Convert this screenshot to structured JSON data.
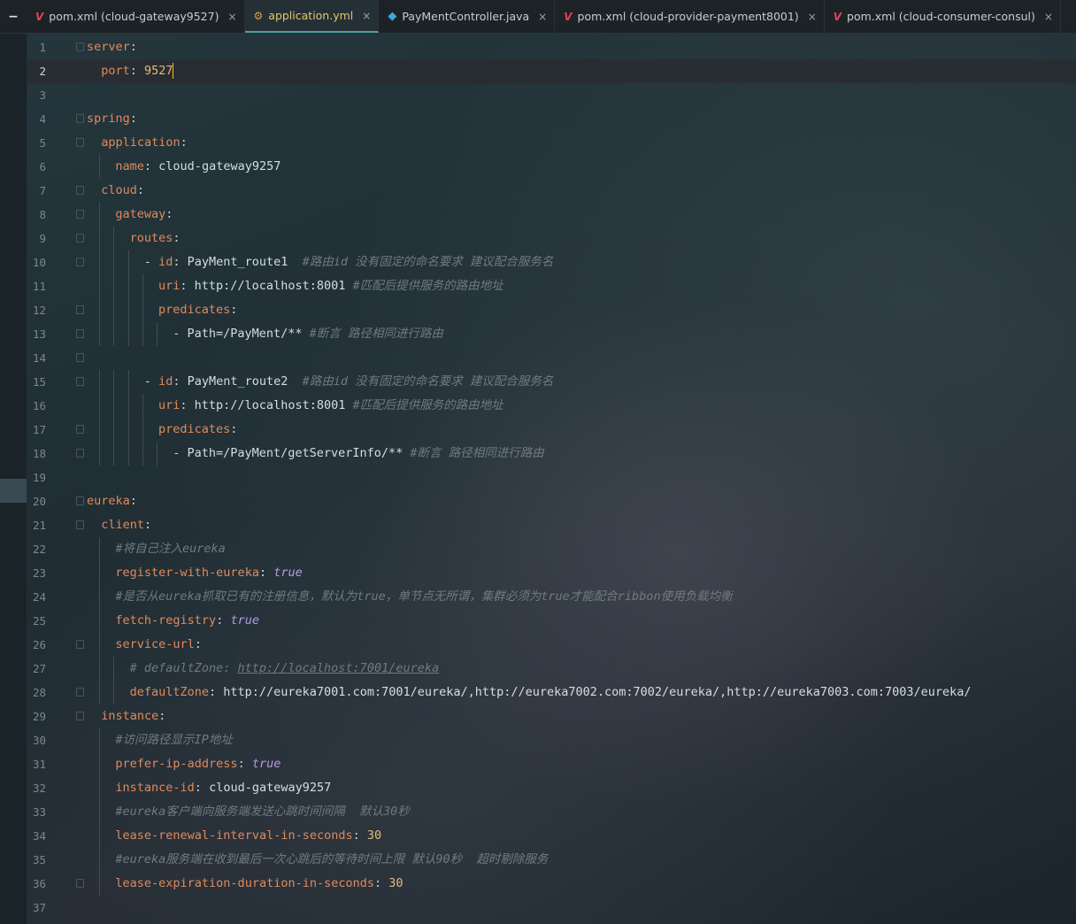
{
  "tabs": [
    {
      "label": "pom.xml (cloud-gateway9527)",
      "icon": "maven-icon",
      "active": false
    },
    {
      "label": "application.yml",
      "icon": "yaml-icon",
      "active": true
    },
    {
      "label": "PayMentController.java",
      "icon": "java-class-icon",
      "active": false
    },
    {
      "label": "pom.xml (cloud-provider-payment8001)",
      "icon": "maven-icon",
      "active": false
    },
    {
      "label": "pom.xml (cloud-consumer-consul)",
      "icon": "maven-icon",
      "active": false
    }
  ],
  "tab_collapse_glyph": "−",
  "tab_close_glyph": "×",
  "colors": {
    "key": "#e08a5b",
    "number": "#e8b873",
    "boolean": "#b79ae6",
    "comment": "#6f7b80",
    "caret": "#f0c020",
    "active_tab_text": "#e8c66a"
  },
  "editor": {
    "current_line": 2,
    "lines": [
      {
        "n": "1",
        "key": "server",
        "sep": ":"
      },
      {
        "n": "2",
        "key": "port",
        "sep": ": ",
        "val": "9527",
        "vt": "n"
      },
      {
        "n": "3"
      },
      {
        "n": "4",
        "key": "spring",
        "sep": ":"
      },
      {
        "n": "5",
        "key": "application",
        "sep": ":"
      },
      {
        "n": "6",
        "key": "name",
        "sep": ": ",
        "val": "cloud-gateway9257"
      },
      {
        "n": "7",
        "key": "cloud",
        "sep": ":"
      },
      {
        "n": "8",
        "key": "gateway",
        "sep": ":"
      },
      {
        "n": "9",
        "key": "routes",
        "sep": ":"
      },
      {
        "n": "10",
        "pre": "- ",
        "key": "id",
        "sep": ": ",
        "val": "PayMent_route1",
        "cm": "  #路由id 没有固定的命名要求 建议配合服务名"
      },
      {
        "n": "11",
        "key": "uri",
        "sep": ": ",
        "val": "http://localhost:8001",
        "cm": " #匹配后提供服务的路由地址"
      },
      {
        "n": "12",
        "key": "predicates",
        "sep": ":"
      },
      {
        "n": "13",
        "pre": "- ",
        "val": "Path=/PayMent/**",
        "cm": " #断言 路径相同进行路由"
      },
      {
        "n": "14"
      },
      {
        "n": "15",
        "pre": "- ",
        "key": "id",
        "sep": ": ",
        "val": "PayMent_route2",
        "cm": "  #路由id 没有固定的命名要求 建议配合服务名"
      },
      {
        "n": "16",
        "key": "uri",
        "sep": ": ",
        "val": "http://localhost:8001",
        "cm": " #匹配后提供服务的路由地址"
      },
      {
        "n": "17",
        "key": "predicates",
        "sep": ":"
      },
      {
        "n": "18",
        "pre": "- ",
        "val": "Path=/PayMent/getServerInfo/**",
        "cm": " #断言 路径相同进行路由"
      },
      {
        "n": "19"
      },
      {
        "n": "20",
        "key": "eureka",
        "sep": ":"
      },
      {
        "n": "21",
        "key": "client",
        "sep": ":"
      },
      {
        "n": "22",
        "cm": "#将自己注入eureka"
      },
      {
        "n": "23",
        "key": "register-with-eureka",
        "sep": ": ",
        "val": "true",
        "vt": "b"
      },
      {
        "n": "24",
        "cm": "#是否从eureka抓取已有的注册信息，默认为true，单节点无所谓，集群必须为true才能配合ribbon使用负载均衡"
      },
      {
        "n": "25",
        "key": "fetch-registry",
        "sep": ": ",
        "val": "true",
        "vt": "b"
      },
      {
        "n": "26",
        "key": "service-url",
        "sep": ":"
      },
      {
        "n": "27",
        "cm": "# defaultZone: ",
        "cmlink": "http://localhost:7001/eureka"
      },
      {
        "n": "28",
        "key": "defaultZone",
        "sep": ": ",
        "val": "http://eureka7001.com:7001/eureka/,http://eureka7002.com:7002/eureka/,http://eureka7003.com:7003/eureka/"
      },
      {
        "n": "29",
        "key": "instance",
        "sep": ":"
      },
      {
        "n": "30",
        "cm": "#访问路径显示IP地址"
      },
      {
        "n": "31",
        "key": "prefer-ip-address",
        "sep": ": ",
        "val": "true",
        "vt": "b"
      },
      {
        "n": "32",
        "key": "instance-id",
        "sep": ": ",
        "val": "cloud-gateway9257"
      },
      {
        "n": "33",
        "cm": "#eureka客户端向服务端发送心跳时间间隔  默认30秒"
      },
      {
        "n": "34",
        "key": "lease-renewal-interval-in-seconds",
        "sep": ": ",
        "val": "30",
        "vt": "n"
      },
      {
        "n": "35",
        "cm": "#eureka服务端在收到最后一次心跳后的等待时间上限 默认90秒  超时剔除服务"
      },
      {
        "n": "36",
        "key": "lease-expiration-duration-in-seconds",
        "sep": ": ",
        "val": "30",
        "vt": "n"
      },
      {
        "n": "37"
      }
    ]
  }
}
